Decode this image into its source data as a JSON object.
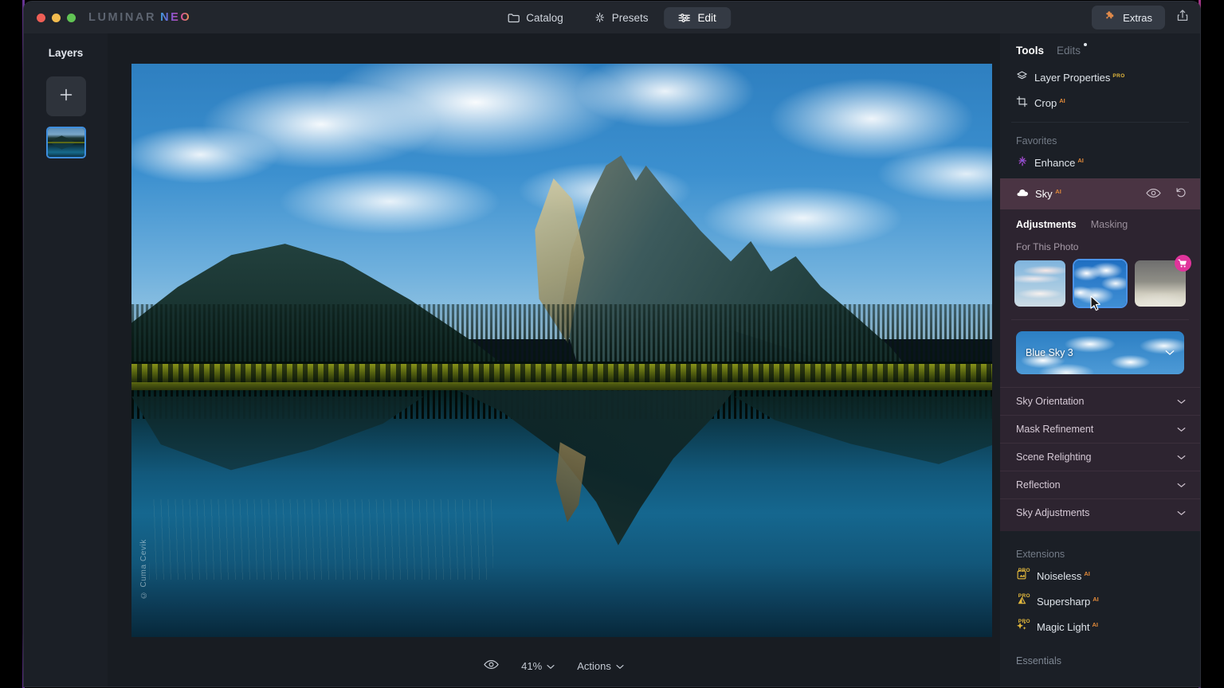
{
  "app": {
    "brand_prefix": "LUMINAR ",
    "brand_suffix": "NEO"
  },
  "titlebar": {
    "tabs": [
      {
        "label": "Catalog",
        "icon": "folder-icon",
        "active": false
      },
      {
        "label": "Presets",
        "icon": "sparkle-icon",
        "active": false
      },
      {
        "label": "Edit",
        "icon": "sliders-icon",
        "active": true
      }
    ],
    "extras_label": "Extras",
    "extras_icon": "puzzle-icon",
    "share_icon": "share-icon",
    "traffic_lights": [
      "close-red",
      "minimize-yellow",
      "maximize-green"
    ]
  },
  "layers": {
    "title": "Layers",
    "add_icon": "plus-icon",
    "thumbnail_name": "mountain-lake-layer"
  },
  "canvas": {
    "watermark": "© Cuma Cevik",
    "photo_description": "Mount Rundle reflected in Vermilion Lakes, Banff"
  },
  "bottombar": {
    "preview_icon": "eye-icon",
    "zoom_level": "41%",
    "actions_label": "Actions",
    "chevron_icon": "chevron-down-icon"
  },
  "right_panel": {
    "tabs": [
      {
        "label": "Tools",
        "active": true,
        "dot": false
      },
      {
        "label": "Edits",
        "active": false,
        "dot": true
      }
    ],
    "top_tools": [
      {
        "label": "Layer Properties",
        "icon": "layers-icon",
        "badge": "PRO",
        "badge_type": "pro"
      },
      {
        "label": "Crop",
        "icon": "crop-icon",
        "badge": "AI",
        "badge_type": "ai"
      }
    ],
    "favorites_label": "Favorites",
    "favorites": [
      {
        "label": "Enhance",
        "icon": "enhance-sparkle-icon",
        "badge": "AI",
        "badge_type": "ai"
      }
    ],
    "sky_tool": {
      "title": "Sky",
      "icon": "cloud-icon",
      "badge": "AI",
      "visibility_icon": "eye-icon",
      "reset_icon": "undo-icon",
      "subtabs": [
        {
          "label": "Adjustments",
          "active": true
        },
        {
          "label": "Masking",
          "active": false
        }
      ],
      "for_this_photo_label": "For This Photo",
      "thumbnails": [
        {
          "name": "wispy-sky-thumbnail",
          "selected": false,
          "locked": false
        },
        {
          "name": "blue-sky-thumbnail",
          "selected": true,
          "locked": false
        },
        {
          "name": "pale-sky-thumbnail",
          "selected": false,
          "locked": true,
          "badge_icon": "cart-icon"
        }
      ],
      "selected_sky": "Blue Sky 3",
      "selector_chevron": "chevron-down-icon",
      "accordions": [
        {
          "label": "Sky Orientation",
          "icon": "chevron-down-icon"
        },
        {
          "label": "Mask Refinement",
          "icon": "chevron-down-icon"
        },
        {
          "label": "Scene Relighting",
          "icon": "chevron-down-icon"
        },
        {
          "label": "Reflection",
          "icon": "chevron-down-icon"
        },
        {
          "label": "Sky Adjustments",
          "icon": "chevron-down-icon"
        }
      ]
    },
    "extensions_label": "Extensions",
    "extensions": [
      {
        "label": "Noiseless",
        "icon": "noiseless-icon",
        "badge": "AI",
        "pro": "PRO"
      },
      {
        "label": "Supersharp",
        "icon": "supersharp-icon",
        "badge": "AI",
        "pro": "PRO"
      },
      {
        "label": "Magic Light",
        "icon": "magic-light-icon",
        "badge": "AI",
        "pro": "PRO"
      }
    ],
    "essentials_label": "Essentials"
  },
  "colors": {
    "accent_blue": "#4a93e8",
    "sky_panel_header": "#4a3443",
    "sky_panel_body": "#2d2430",
    "badge_pro": "#e4b93c",
    "badge_ai": "#e0893a",
    "cart_badge": "#e0349b",
    "panel_bg": "#1b1f26",
    "titlebar_bg": "#22262d"
  }
}
